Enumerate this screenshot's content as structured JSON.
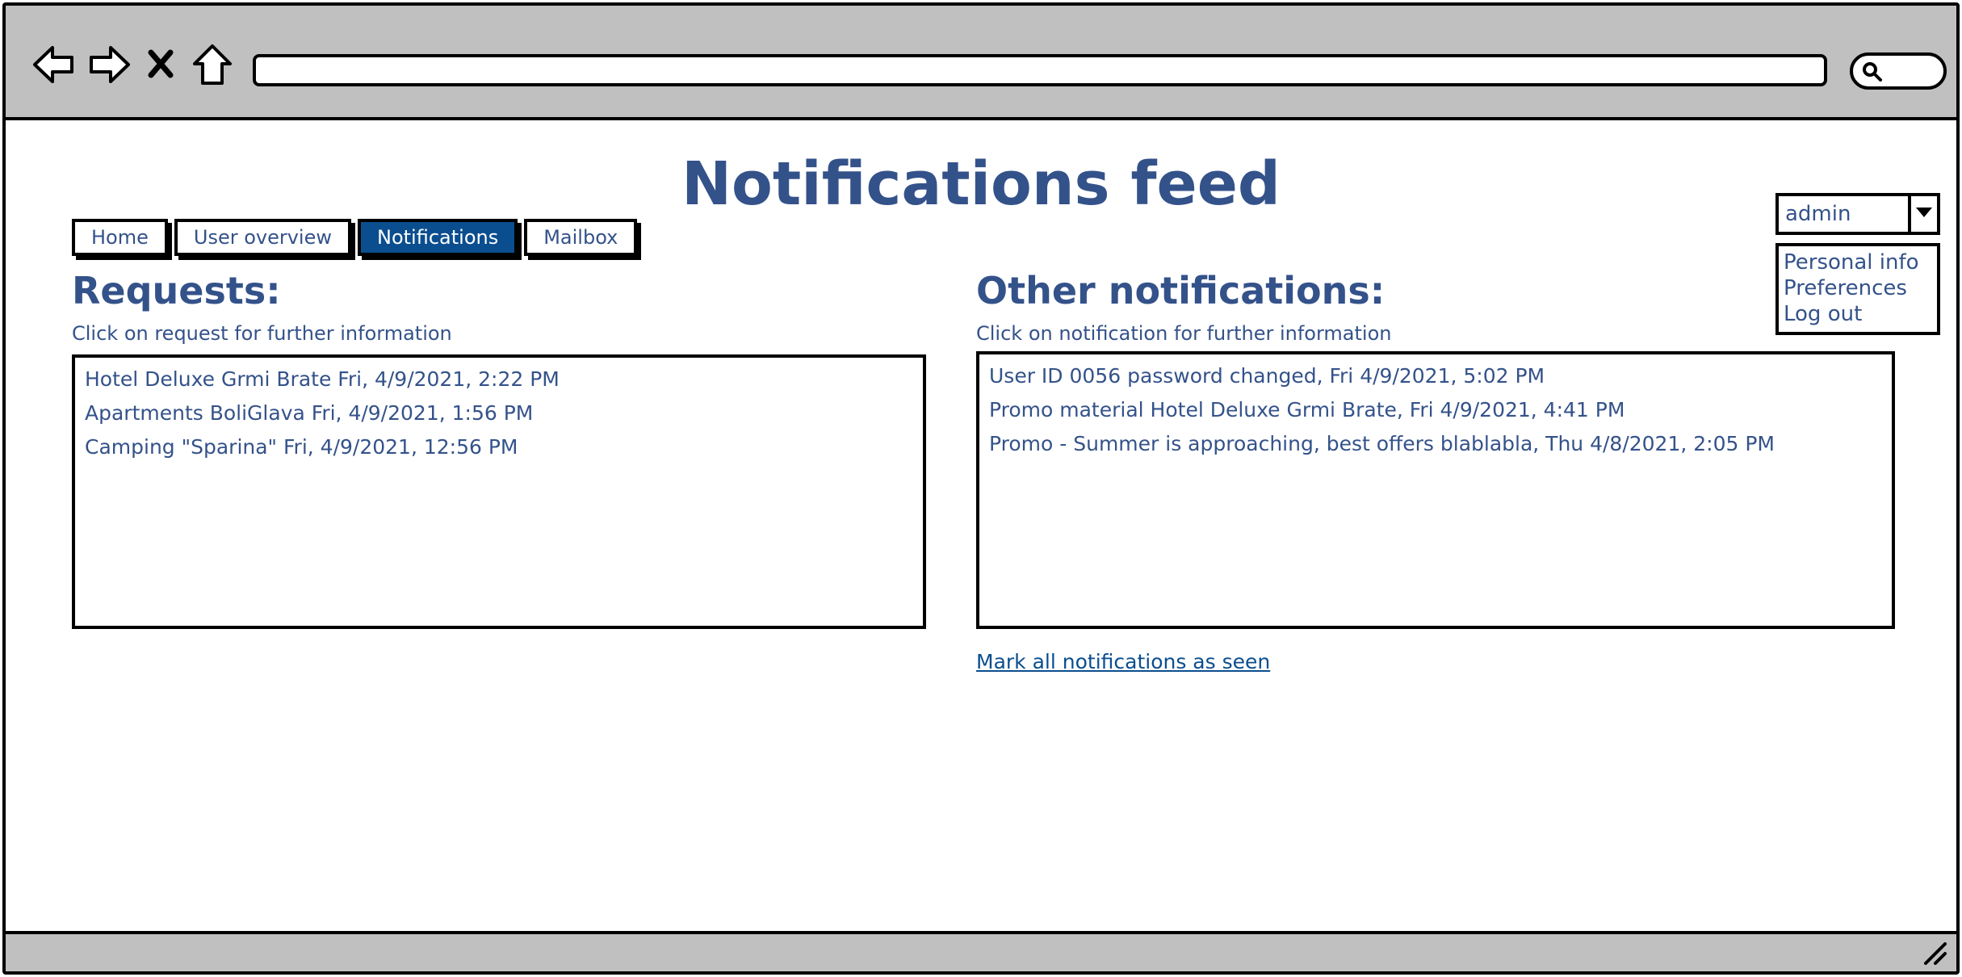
{
  "browser": {
    "back_icon": "back-arrow-icon",
    "forward_icon": "forward-arrow-icon",
    "stop_icon": "close-icon",
    "home_icon": "home-icon",
    "address": "",
    "search_icon": "search-icon"
  },
  "page": {
    "title": "Notifications feed"
  },
  "tabs": [
    {
      "label": "Home",
      "active": false
    },
    {
      "label": "User overview",
      "active": false
    },
    {
      "label": "Notifications",
      "active": true
    },
    {
      "label": "Mailbox",
      "active": false
    }
  ],
  "user_menu": {
    "selected": "admin",
    "items": [
      "Personal info",
      "Preferences",
      "Log out"
    ]
  },
  "requests": {
    "title": "Requests:",
    "hint": "Click on request for further information",
    "items": [
      "Hotel Deluxe Grmi Brate Fri, 4/9/2021, 2:22 PM",
      "Apartments BoliGlava Fri, 4/9/2021, 1:56 PM",
      "Camping \"Sparina\" Fri, 4/9/2021, 12:56 PM"
    ]
  },
  "other": {
    "title": "Other notifications:",
    "hint": "Click on notification for further information",
    "items": [
      "User ID 0056 password changed, Fri 4/9/2021, 5:02 PM",
      "Promo material Hotel Deluxe Grmi Brate, Fri 4/9/2021, 4:41 PM",
      "Promo - Summer is approaching, best offers blablabla, Thu 4/8/2021, 2:05 PM"
    ],
    "mark_all_label": "Mark all notifications as seen"
  },
  "colors": {
    "text": "#34528a",
    "active_tab": "#0b4e8f",
    "chrome": "#c0c0c0"
  }
}
